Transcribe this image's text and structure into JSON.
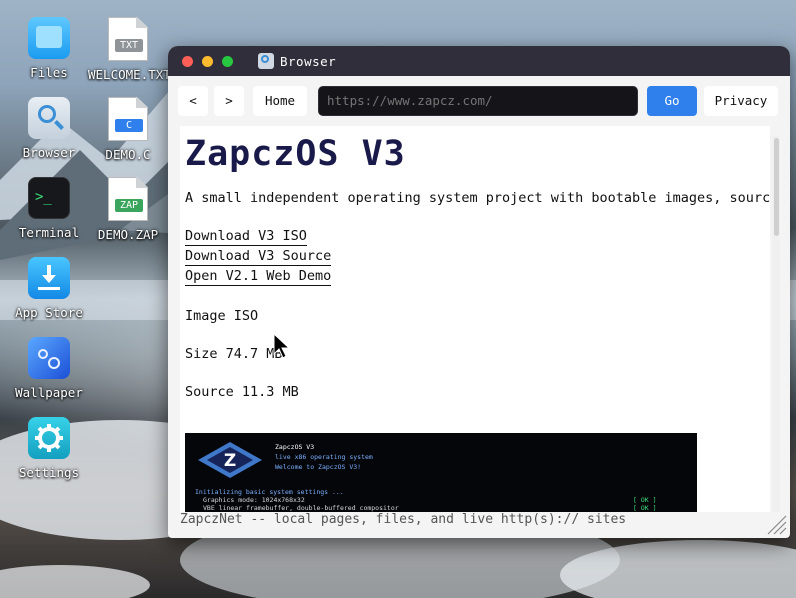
{
  "desktop": {
    "icons": [
      {
        "label": "Files",
        "icon": "folder-icon"
      },
      {
        "label": "WELCOME.TXT",
        "icon": "txt-file-icon",
        "tag": "TXT"
      },
      {
        "label": "Browser",
        "icon": "magnifier-icon"
      },
      {
        "label": "DEMO.C",
        "icon": "c-file-icon",
        "tag": "C"
      },
      {
        "label": "Terminal",
        "icon": "terminal-icon",
        "glyph": ">_"
      },
      {
        "label": "DEMO.ZAP",
        "icon": "zap-file-icon",
        "tag": "ZAP"
      },
      {
        "label": "App Store",
        "icon": "download-icon"
      },
      {
        "label": "Wallpaper",
        "icon": "wallpaper-icon"
      },
      {
        "label": "Settings",
        "icon": "gear-icon"
      }
    ]
  },
  "window": {
    "title": "Browser",
    "toolbar": {
      "back": "<",
      "forward": ">",
      "home": "Home",
      "url_placeholder": "https://www.zapcz.com/",
      "go": "Go",
      "privacy": "Privacy"
    },
    "page": {
      "heading": "ZapczOS V3",
      "description": "A small independent operating system project with bootable images, source a",
      "links": [
        "Download V3 ISO",
        "Download V3 Source",
        "Open V2.1 Web Demo"
      ],
      "image_label": "Image ISO",
      "size_label": "Size 74.7 MB",
      "source_label": "Source 11.3 MB",
      "screenshot": {
        "logo_letter": "Z",
        "title": "ZapczOS V3",
        "subtitle": "live x86 operating system",
        "welcome": "Welcome to ZapczOS V3!",
        "log_header": "Initializing basic system settings ...",
        "log_lines": [
          {
            "text": "Graphics mode: 1024x768x32",
            "status": "[ OK ]"
          },
          {
            "text": "VBE linear framebuffer, double-buffered compositor",
            "status": "[ OK ]"
          }
        ]
      }
    },
    "status_bar": "ZapczNet -- local pages, files, and live http(s):// sites"
  },
  "colors": {
    "titlebar": "#2f2e3a",
    "accent": "#2f80ed",
    "heading": "#1a1a4a",
    "close": "#ff5f57",
    "minimize": "#febc2e",
    "maximize": "#28c840"
  }
}
